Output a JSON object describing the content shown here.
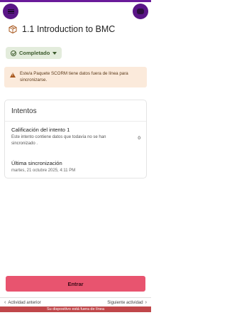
{
  "header": {
    "menu_icon": "hamburger-menu-icon",
    "options_icon": "options-icon",
    "title": "1.1 Introduction to BMC",
    "title_icon": "package-box-icon"
  },
  "status": {
    "label": "Completado",
    "color": "#3c5a2c",
    "background": "#e3ecdc"
  },
  "warning": {
    "text": "Este/a Paquete SCORM tiene datos fuera de línea para sincronizarse.",
    "background": "#fbeadb"
  },
  "attempts": {
    "title": "Intentos",
    "attempt_label": "Calificación del intento 1",
    "attempt_desc": "Este intento contiene datos que todavía no se han sincronizado .",
    "attempt_score": "0",
    "sync_label": "Última sincronización",
    "sync_date": "martes, 21 octubre 2025, 4:11 PM"
  },
  "actions": {
    "enter_label": "Entrar",
    "enter_color": "#e8546f"
  },
  "navigation": {
    "prev_label": "Actividad anterior",
    "next_label": "Siguiente actividad"
  },
  "offline": {
    "text": "Su dispositivo está fuera de línea",
    "color": "#c0474a"
  }
}
